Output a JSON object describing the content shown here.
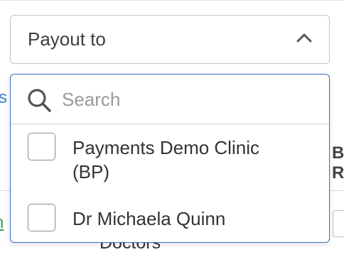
{
  "background": {
    "link_fragment_1": "s",
    "link_fragment_2": "n",
    "column_header_line1": "B",
    "column_header_line2": "R",
    "doctors_text": "Doctors"
  },
  "payout_select": {
    "label": "Payout to",
    "chevron_icon": "chevron-up-icon",
    "expanded": true
  },
  "dropdown": {
    "search_icon": "search-icon",
    "search_placeholder": "Search",
    "search_value": "",
    "options": [
      {
        "label": "Payments Demo Clinic (BP)",
        "checked": false
      },
      {
        "label": "Dr Michaela Quinn",
        "checked": false
      }
    ]
  },
  "colors": {
    "dropdown_border": "#3a6fc4",
    "link_blue": "#3a7bd5",
    "link_green": "#3aa35c",
    "placeholder": "#9a9a9a"
  }
}
